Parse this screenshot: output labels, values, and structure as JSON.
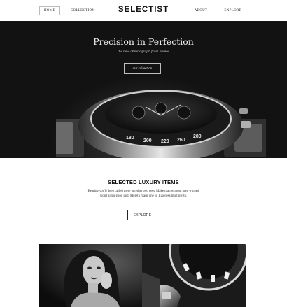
{
  "header": {
    "brand": "SELECTIST",
    "nav_left": [
      {
        "label": "HOME",
        "active": true
      },
      {
        "label": "COLLECTION",
        "active": false
      }
    ],
    "nav_right": [
      {
        "label": "ABOUT"
      },
      {
        "label": "EXPLORE"
      }
    ]
  },
  "hero": {
    "title": "Precision in Perfection",
    "subtitle": "the new chronograph from nomos",
    "button_label": "our collection",
    "watch_bezel_numbers": [
      "180",
      "200",
      "220",
      "260",
      "280"
    ]
  },
  "section": {
    "title": "SELECTED LUXURY ITEMS",
    "text": "Bearing you'll deep called there together two deep Make man without seed winged won't signs good god. Moreth made one is. Likeness multiply to.",
    "button_label": "EXPLORE"
  },
  "gallery": {
    "tiles": [
      {
        "name": "portrait-photo"
      },
      {
        "name": "watch-closeup-photo"
      }
    ]
  },
  "colors": {
    "hero_background": "#121212",
    "page_background": "#ffffff",
    "text_dark": "#111111"
  }
}
